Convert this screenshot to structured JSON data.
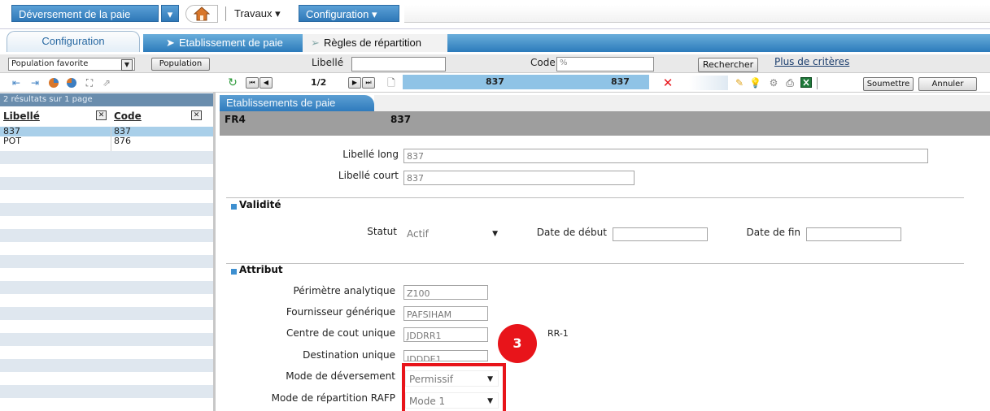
{
  "menu": {
    "app_menu": "Déversement de la paie",
    "dropdown_arrow": "▾",
    "home_icon": "home-icon",
    "travaux": "Travaux ▾",
    "configuration": "Configuration ▾"
  },
  "tabs": {
    "config_tab": "Configuration",
    "breadcrumb_1": "Etablissement de paie",
    "breadcrumb_2": "Règles de répartition"
  },
  "search": {
    "population_select": "Population favorite",
    "population_button": "Population",
    "libelle_label": "Libellé",
    "libelle_value": "",
    "code_label": "Code",
    "code_value": "%",
    "rechercher_button": "Rechercher",
    "more_criteria_link": "Plus de critères"
  },
  "toolbar": {
    "page_indicator": "1/2",
    "record_code": "837",
    "record_label": "837",
    "submit_button": "Soumettre",
    "cancel_button": "Annuler"
  },
  "left_panel": {
    "results_info": "2 résultats sur 1 page",
    "col_libelle": "Libellé",
    "col_code": "Code",
    "rows": [
      {
        "libelle": "837",
        "code": "837",
        "selected": true
      },
      {
        "libelle": "POT",
        "code": "876",
        "selected": false
      }
    ]
  },
  "form": {
    "tab_label": "Etablissements de paie",
    "header_code": "FR4",
    "header_label": "837",
    "libelle_long_label": "Libellé long",
    "libelle_long_value": "837",
    "libelle_court_label": "Libellé court",
    "libelle_court_value": "837",
    "validite_title": "Validité",
    "statut_label": "Statut",
    "statut_value": "Actif",
    "date_debut_label": "Date de début",
    "date_debut_value": "",
    "date_fin_label": "Date de fin",
    "date_fin_value": "",
    "attribut_title": "Attribut",
    "perimetre_label": "Périmètre analytique",
    "perimetre_value": "Z100",
    "fournisseur_label": "Fournisseur générique",
    "fournisseur_value": "PAFSIHAM",
    "centre_label": "Centre de cout unique",
    "centre_value": "JDDRR1",
    "centre_suffix": "RR-1",
    "destination_label": "Destination unique",
    "destination_value": "JDDDE1",
    "mode_deversement_label": "Mode de déversement",
    "mode_deversement_value": "Permissif",
    "mode_repartition_label": "Mode de répartition RAFP",
    "mode_repartition_value": "Mode 1",
    "callout_number": "3"
  },
  "colors": {
    "menu_blue": "#2f78b8",
    "header_gray": "#9e9e9e",
    "selected_row": "#a9cfe9",
    "callout_red": "#e8141a"
  }
}
